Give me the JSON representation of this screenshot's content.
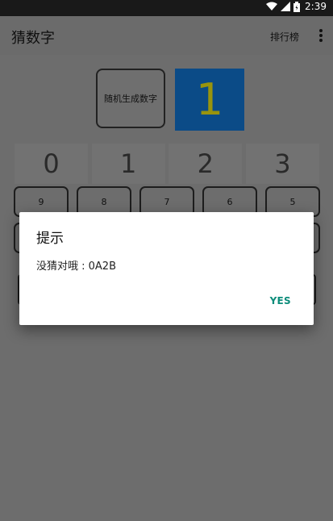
{
  "statusbar": {
    "time": "2:39"
  },
  "appbar": {
    "title": "猜数字",
    "menu_label": "排行榜"
  },
  "controls": {
    "generate_label": "随机生成数字",
    "counter": "1"
  },
  "digits": [
    "0",
    "1",
    "2",
    "3"
  ],
  "keypad": {
    "row1": [
      "9",
      "8",
      "7",
      "6",
      "5"
    ],
    "row2": [
      "",
      "",
      "",
      "",
      ""
    ]
  },
  "dialog": {
    "title": "提示",
    "message": "没猜对哦 : 0A2B",
    "confirm": "YES"
  },
  "colors": {
    "accent": "#0c8c7a",
    "counter_bg": "#0b4b87",
    "counter_text": "#99940d"
  }
}
